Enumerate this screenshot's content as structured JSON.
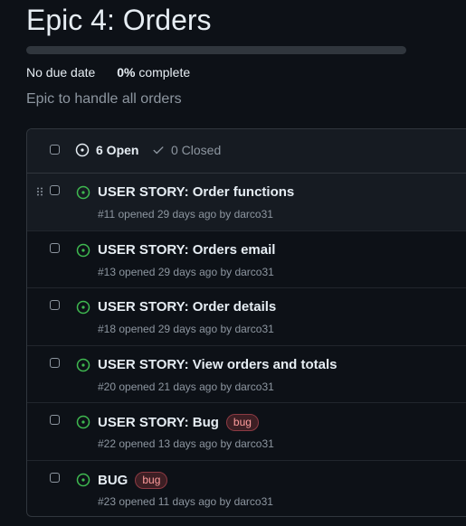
{
  "milestone": {
    "title": "Epic 4: Orders",
    "due": "No due date",
    "percent": "0%",
    "percent_suffix": "complete",
    "progress_fraction": 0,
    "description": "Epic to handle all orders"
  },
  "filters": {
    "open_label": "6 Open",
    "closed_label": "0 Closed"
  },
  "issues": [
    {
      "title": "USER STORY: Order functions",
      "meta": "#11 opened 29 days ago by darco31",
      "label": ""
    },
    {
      "title": "USER STORY: Orders email",
      "meta": "#13 opened 29 days ago by darco31",
      "label": ""
    },
    {
      "title": "USER STORY: Order details",
      "meta": "#18 opened 29 days ago by darco31",
      "label": ""
    },
    {
      "title": "USER STORY: View orders and totals",
      "meta": "#20 opened 21 days ago by darco31",
      "label": ""
    },
    {
      "title": "USER STORY: Bug",
      "meta": "#22 opened 13 days ago by darco31",
      "label": "bug"
    },
    {
      "title": "BUG",
      "meta": "#23 opened 11 days ago by darco31",
      "label": "bug"
    }
  ],
  "colors": {
    "background": "#0d1117",
    "open_icon": "#3fb950",
    "bug_label_text": "#ff9d9d",
    "progress_track": "#30363d"
  },
  "icons": {
    "open": "issue-opened-icon",
    "closed": "check-icon",
    "drag": "grabber-icon"
  }
}
